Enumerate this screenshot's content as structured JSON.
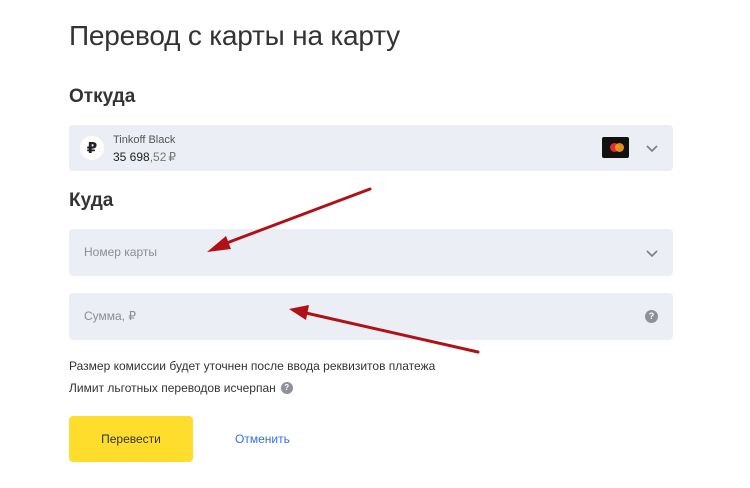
{
  "page": {
    "title": "Перевод с карты на карту"
  },
  "from": {
    "section_title": "Откуда",
    "card_name": "Tinkoff Black",
    "balance_main": "35 698",
    "balance_cents": ",52",
    "balance_currency": "₽",
    "currency_badge": "₽"
  },
  "to": {
    "section_title": "Куда",
    "card_number_placeholder": "Номер карты",
    "amount_placeholder": "Сумма, ₽"
  },
  "notes": {
    "commission": "Размер комиссии будет уточнен после ввода реквизитов платежа",
    "limit": "Лимит льготных переводов исчерпан"
  },
  "actions": {
    "submit_label": "Перевести",
    "cancel_label": "Отменить"
  },
  "icons": {
    "help": "?",
    "chevron": "chevron-down-icon",
    "arrow": "red-arrow-icon"
  },
  "colors": {
    "accent_yellow": "#ffdd2d",
    "link_blue": "#336fee",
    "field_bg": "#eceef5",
    "arrow_red": "#b01116"
  }
}
